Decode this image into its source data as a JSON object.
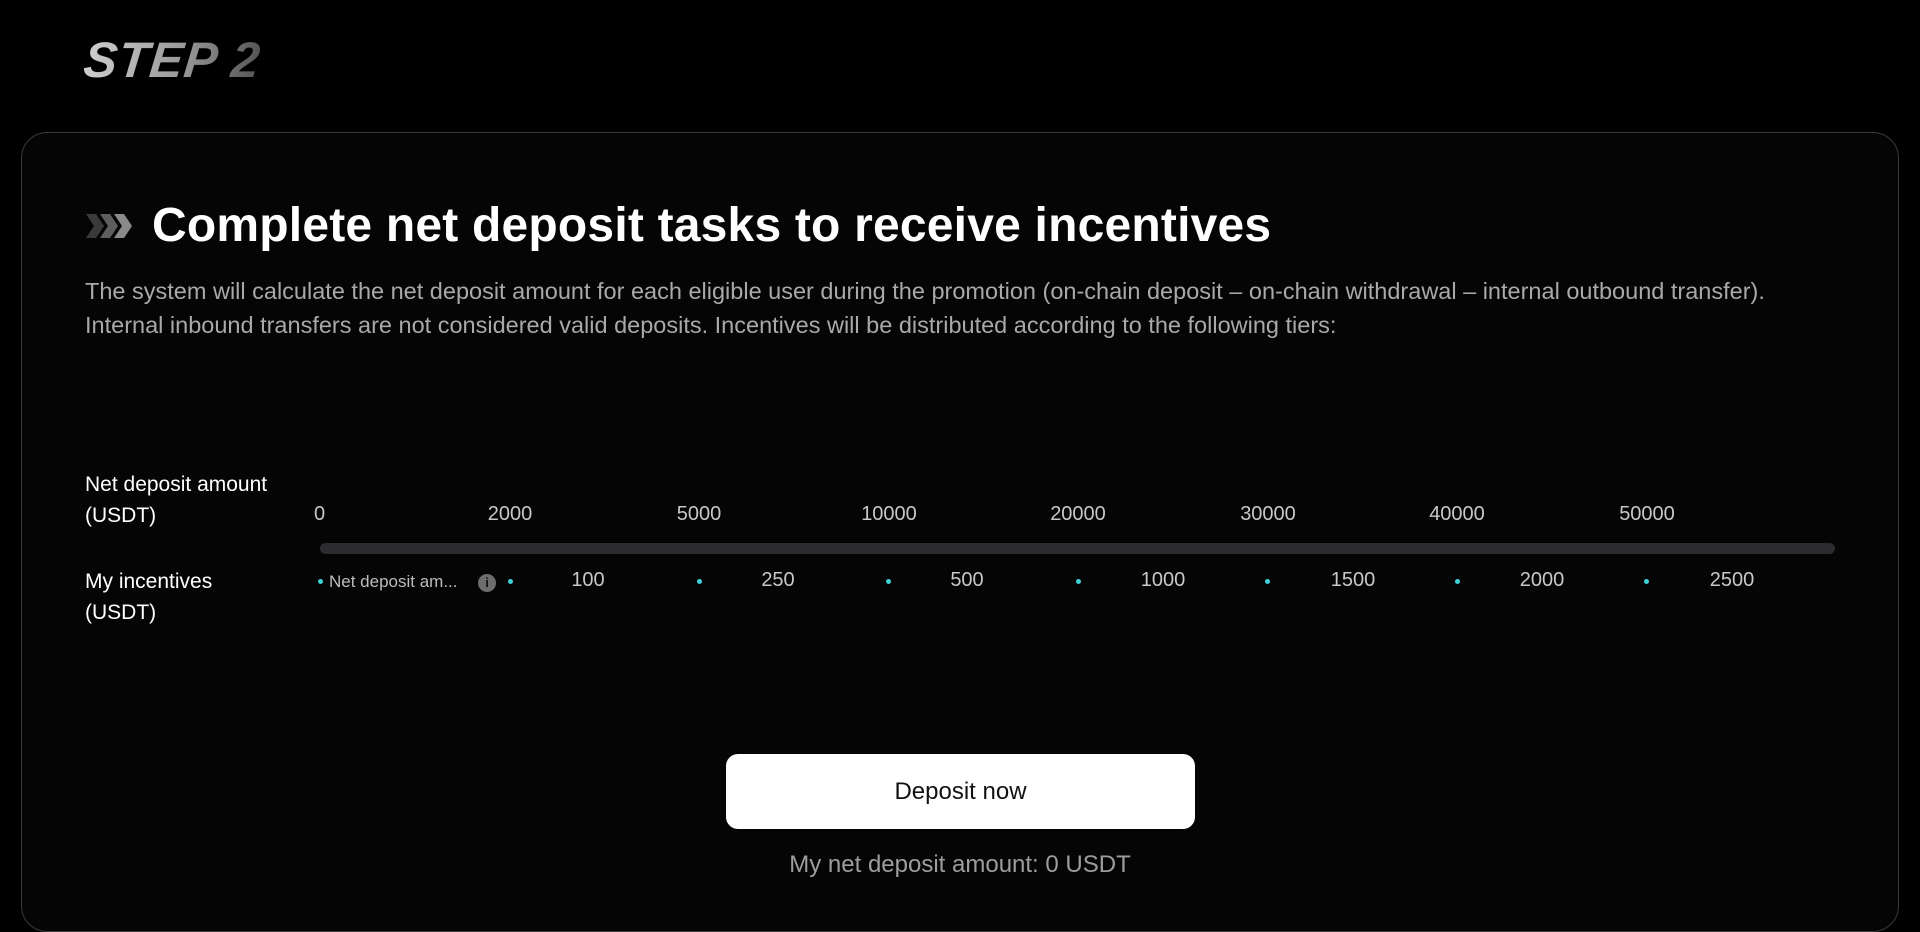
{
  "step": {
    "title": "STEP 2"
  },
  "task": {
    "headline": "Complete net deposit tasks to receive incentives",
    "description": "The system will calculate the net deposit amount for each eligible user during the promotion (on-chain deposit – on-chain withdrawal – internal outbound transfer). Internal inbound transfers are not considered valid deposits. Incentives will be distributed according to the following tiers:"
  },
  "tiers": {
    "deposit_label_line1": "Net deposit amount",
    "deposit_label_line2": "(USDT)",
    "incentive_label_line1": "My incentives",
    "incentive_label_line2": "(USDT)",
    "deposit_amounts": [
      "0",
      "2000",
      "5000",
      "10000",
      "20000",
      "30000",
      "40000",
      "50000"
    ],
    "incentive_placeholder": "Net deposit am...",
    "incentives": [
      "100",
      "250",
      "500",
      "1000",
      "1500",
      "2000",
      "2500"
    ],
    "accent_color": "#3fd1d7"
  },
  "cta": {
    "deposit_button": "Deposit now",
    "status_text": "My net deposit amount: 0 USDT"
  },
  "icons": {
    "headline_icon": "chevrons-right-icon",
    "info_icon": "info-icon"
  }
}
